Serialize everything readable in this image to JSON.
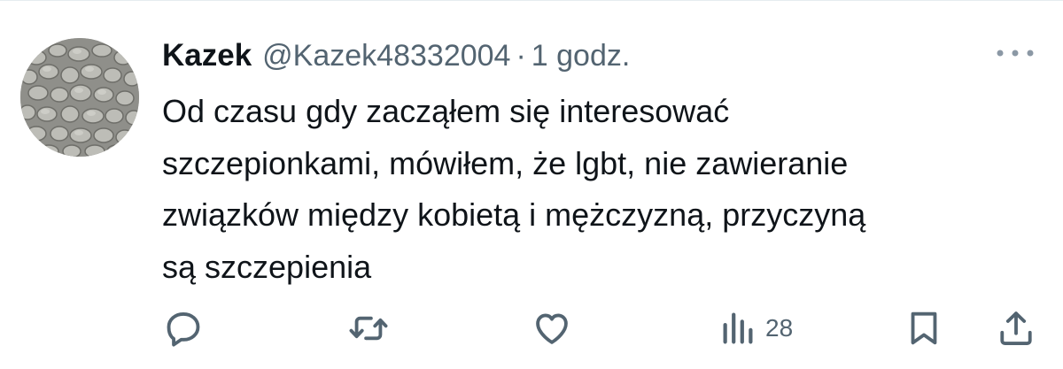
{
  "tweet": {
    "author_name": "Kazek",
    "author_handle": "@Kazek48332004",
    "separator": "·",
    "time": "1 godz.",
    "text_lines": [
      "Od czasu gdy zacząłem się interesować",
      "szczepionkami, mówiłem, że lgbt, nie zawieranie",
      "związków między kobietą i mężczyzną, przyczyną",
      "są szczepienia"
    ]
  },
  "actions": {
    "reply_icon": "reply-icon",
    "retweet_icon": "retweet-icon",
    "like_icon": "heart-icon",
    "views_icon": "views-icon",
    "views_count": "28",
    "bookmark_icon": "bookmark-icon",
    "share_icon": "share-icon",
    "more_icon": "more-icon"
  },
  "colors": {
    "text": "#0f1419",
    "secondary": "#536471",
    "icon": "#536471"
  }
}
